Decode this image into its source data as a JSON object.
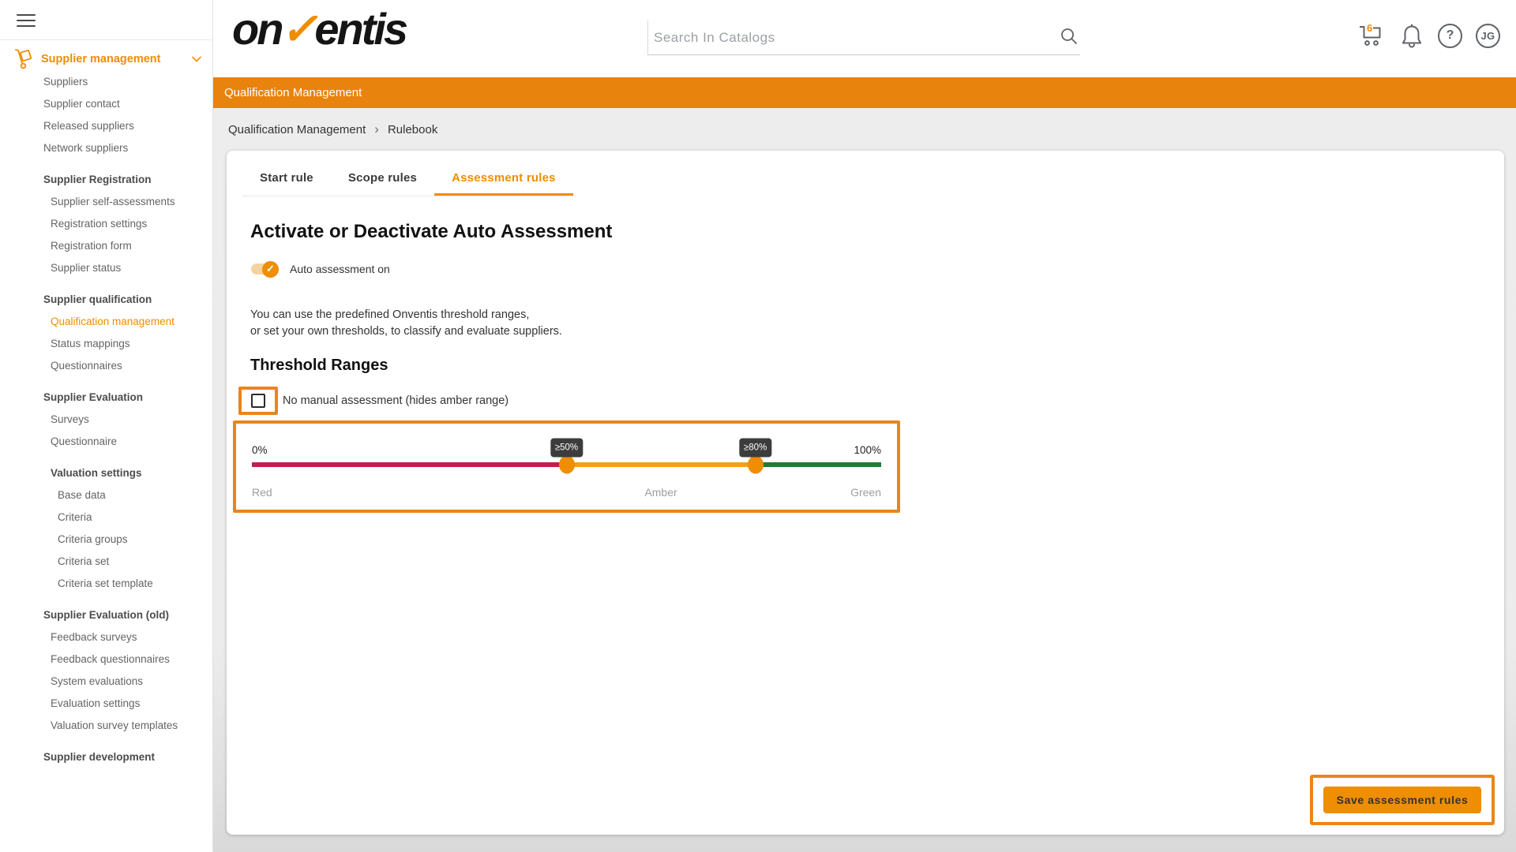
{
  "colors": {
    "brand_orange": "#e8830d",
    "accent_orange": "#ef8d03",
    "annotation_orange": "#ea851b",
    "tooltip_bg": "#3c3c3c",
    "toggle_track": "#f5d3a1"
  },
  "header": {
    "logo_on": "on",
    "logo_check": "✓",
    "logo_rest": "entis",
    "search_placeholder": "Search In Catalogs",
    "cart_badge": "6",
    "help_glyph": "?",
    "avatar_initials": "JG"
  },
  "banner": {
    "title": "Qualification Management"
  },
  "breadcrumb": {
    "parent": "Qualification Management",
    "separator": "›",
    "current": "Rulebook"
  },
  "sidebar": {
    "root": {
      "label": "Supplier management"
    },
    "entries": [
      {
        "type": "item",
        "indent": 1,
        "label": "Suppliers"
      },
      {
        "type": "item",
        "indent": 1,
        "label": "Supplier contact"
      },
      {
        "type": "item",
        "indent": 1,
        "label": "Released suppliers"
      },
      {
        "type": "item",
        "indent": 1,
        "label": "Network suppliers"
      },
      {
        "type": "header",
        "indent": 1,
        "label": "Supplier Registration"
      },
      {
        "type": "item",
        "indent": 2,
        "label": "Supplier self-assessments"
      },
      {
        "type": "item",
        "indent": 2,
        "label": "Registration settings"
      },
      {
        "type": "item",
        "indent": 2,
        "label": "Registration form"
      },
      {
        "type": "item",
        "indent": 2,
        "label": "Supplier status"
      },
      {
        "type": "header",
        "indent": 1,
        "label": "Supplier qualification"
      },
      {
        "type": "item",
        "indent": 2,
        "label": "Qualification management",
        "active": true
      },
      {
        "type": "item",
        "indent": 2,
        "label": "Status mappings"
      },
      {
        "type": "item",
        "indent": 2,
        "label": "Questionnaires"
      },
      {
        "type": "header",
        "indent": 1,
        "label": "Supplier Evaluation"
      },
      {
        "type": "item",
        "indent": 2,
        "label": "Surveys"
      },
      {
        "type": "item",
        "indent": 2,
        "label": "Questionnaire"
      },
      {
        "type": "header",
        "indent": 2,
        "label": "Valuation settings"
      },
      {
        "type": "item",
        "indent": 3,
        "label": "Base data"
      },
      {
        "type": "item",
        "indent": 3,
        "label": "Criteria"
      },
      {
        "type": "item",
        "indent": 3,
        "label": "Criteria groups"
      },
      {
        "type": "item",
        "indent": 3,
        "label": "Criteria set"
      },
      {
        "type": "item",
        "indent": 3,
        "label": "Criteria set template"
      },
      {
        "type": "header",
        "indent": 1,
        "label": "Supplier Evaluation (old)"
      },
      {
        "type": "item",
        "indent": 2,
        "label": "Feedback surveys"
      },
      {
        "type": "item",
        "indent": 2,
        "label": "Feedback questionnaires"
      },
      {
        "type": "item",
        "indent": 2,
        "label": "System evaluations"
      },
      {
        "type": "item",
        "indent": 2,
        "label": "Evaluation settings"
      },
      {
        "type": "item",
        "indent": 2,
        "label": "Valuation survey templates"
      },
      {
        "type": "header",
        "indent": 1,
        "label": "Supplier development"
      }
    ]
  },
  "tabs": [
    {
      "label": "Start rule",
      "active": false
    },
    {
      "label": "Scope rules",
      "active": false
    },
    {
      "label": "Assessment rules",
      "active": true
    }
  ],
  "main": {
    "heading": "Activate or Deactivate Auto Assessment",
    "toggle_label": "Auto assessment on",
    "toggle_on": true,
    "description_line1": "You can use the predefined Onventis threshold ranges,",
    "description_line2": "or set your own thresholds, to classify and evaluate suppliers.",
    "threshold_heading": "Threshold Ranges",
    "checkbox_label": "No manual assessment (hides amber range)",
    "checkbox_checked": false,
    "save_button_label": "Save assessment rules"
  },
  "slider": {
    "min_label": "0%",
    "max_label": "100%",
    "lower_value": 50,
    "upper_value": 80,
    "lower_tooltip": "≥50%",
    "upper_tooltip": "≥80%",
    "zones": [
      {
        "label": "Red",
        "color": "#c21e4e"
      },
      {
        "label": "Amber",
        "color": "#f0a11c"
      },
      {
        "label": "Green",
        "color": "#1e7d34"
      }
    ]
  }
}
